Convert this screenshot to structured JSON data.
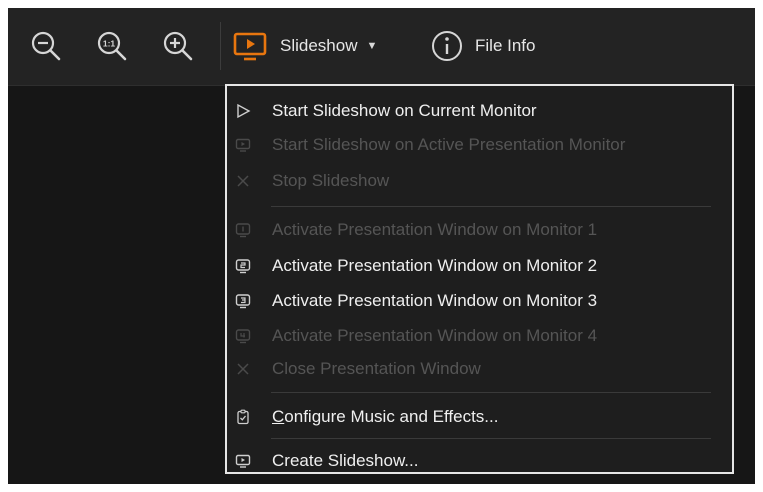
{
  "toolbar": {
    "zoom_out_icon": "zoom-out-icon",
    "zoom_actual_icon": "zoom-actual-size-icon",
    "zoom_actual_glyph": "1:1",
    "zoom_in_icon": "zoom-in-icon",
    "slideshow_icon": "slideshow-icon",
    "slideshow_label": "Slideshow",
    "fileinfo_icon": "info-icon",
    "fileinfo_glyph": "i",
    "fileinfo_label": "File Info"
  },
  "menu": {
    "items": [
      {
        "label": "Start Slideshow on Current Monitor",
        "icon": "play-outline-icon",
        "enabled": true
      },
      {
        "label": "Start Slideshow on Active Presentation Monitor",
        "icon": "monitor-play-icon",
        "enabled": false
      },
      {
        "label": "Stop Slideshow",
        "icon": "close-icon",
        "enabled": false
      },
      {
        "label": "Activate Presentation Window on Monitor 1",
        "icon": "monitor-1-icon",
        "enabled": false
      },
      {
        "label": "Activate Presentation Window on Monitor 2",
        "icon": "monitor-2-icon",
        "enabled": true
      },
      {
        "label": "Activate Presentation Window on Monitor 3",
        "icon": "monitor-3-icon",
        "enabled": true
      },
      {
        "label": "Activate Presentation Window on Monitor 4",
        "icon": "monitor-4-icon",
        "enabled": false
      },
      {
        "label": "Close Presentation Window",
        "icon": "close-icon",
        "enabled": false
      },
      {
        "label_first": "C",
        "label_rest": "onfigure Music and Effects...",
        "icon": "clipboard-check-icon",
        "enabled": true
      },
      {
        "label": "Create Slideshow...",
        "icon": "monitor-play-icon",
        "enabled": true
      }
    ]
  },
  "colors": {
    "accent": "#e8760f",
    "background": "#161616",
    "toolbar": "#232323",
    "menu_border": "#e6e6e6"
  }
}
